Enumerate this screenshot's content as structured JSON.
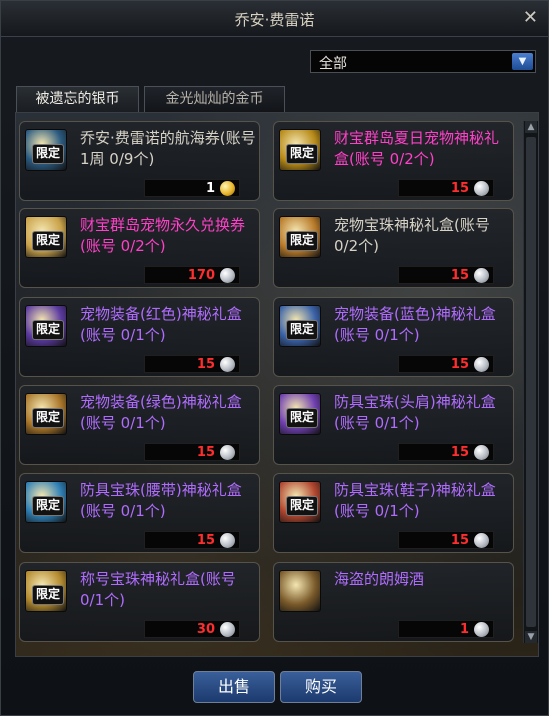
{
  "window": {
    "title": "乔安·费雷诺",
    "close_glyph": "✕"
  },
  "filter": {
    "selected": "全部"
  },
  "tabs": [
    {
      "label": "被遗忘的银币",
      "active": true
    },
    {
      "label": "金光灿灿的金币",
      "active": false
    }
  ],
  "limit_label": "限定",
  "items": [
    {
      "name": "乔安·费雷诺的航海券(账号1周 0/9个)",
      "color": "white",
      "price": "1",
      "currency": "gold",
      "limited": true,
      "icon_name": "voucher-icon",
      "icon_color": "#2b5a80"
    },
    {
      "name": "财宝群岛夏日宠物神秘礼盒(账号 0/2个)",
      "color": "pink",
      "price": "15",
      "currency": "silver",
      "limited": true,
      "icon_name": "gold-box-icon",
      "icon_color": "#b78a18"
    },
    {
      "name": "财宝群岛宠物永久兑换券(账号 0/2个)",
      "color": "pink",
      "price": "170",
      "currency": "silver",
      "limited": true,
      "icon_name": "pet-ticket-icon",
      "icon_color": "#c9a24a"
    },
    {
      "name": "宠物宝珠神秘礼盒(账号 0/2个)",
      "color": "white",
      "price": "15",
      "currency": "silver",
      "limited": true,
      "icon_name": "chest-icon",
      "icon_color": "#b87a2a"
    },
    {
      "name": "宠物装备(红色)神秘礼盒(账号 0/1个)",
      "color": "purple",
      "price": "15",
      "currency": "silver",
      "limited": true,
      "icon_name": "purple-box-icon",
      "icon_color": "#5b3aa0"
    },
    {
      "name": "宠物装备(蓝色)神秘礼盒(账号 0/1个)",
      "color": "purple",
      "price": "15",
      "currency": "silver",
      "limited": true,
      "icon_name": "blue-box-icon",
      "icon_color": "#3a62a8"
    },
    {
      "name": "宠物装备(绿色)神秘礼盒(账号 0/1个)",
      "color": "purple",
      "price": "15",
      "currency": "silver",
      "limited": true,
      "icon_name": "gold-chest-icon",
      "icon_color": "#a8762a"
    },
    {
      "name": "防具宝珠(头肩)神秘礼盒(账号 0/1个)",
      "color": "purple",
      "price": "15",
      "currency": "silver",
      "limited": true,
      "icon_name": "violet-box-icon",
      "icon_color": "#6e3fb0"
    },
    {
      "name": "防具宝珠(腰带)神秘礼盒(账号 0/1个)",
      "color": "purple",
      "price": "15",
      "currency": "silver",
      "limited": true,
      "icon_name": "cyan-box-icon",
      "icon_color": "#2f7fb5"
    },
    {
      "name": "防具宝珠(鞋子)神秘礼盒(账号 0/1个)",
      "color": "purple",
      "price": "15",
      "currency": "silver",
      "limited": true,
      "icon_name": "red-box-icon",
      "icon_color": "#b0462f"
    },
    {
      "name": "称号宝珠神秘礼盒(账号 0/1个)",
      "color": "purple",
      "price": "30",
      "currency": "silver",
      "limited": true,
      "icon_name": "scroll-box-icon",
      "icon_color": "#b38a2e"
    },
    {
      "name": "海盗的朗姆酒",
      "color": "purple",
      "price": "1",
      "currency": "silver",
      "limited": false,
      "icon_name": "rum-mug-icon",
      "icon_color": "#7a5a2a"
    }
  ],
  "buttons": {
    "sell": "出售",
    "buy": "购买"
  }
}
